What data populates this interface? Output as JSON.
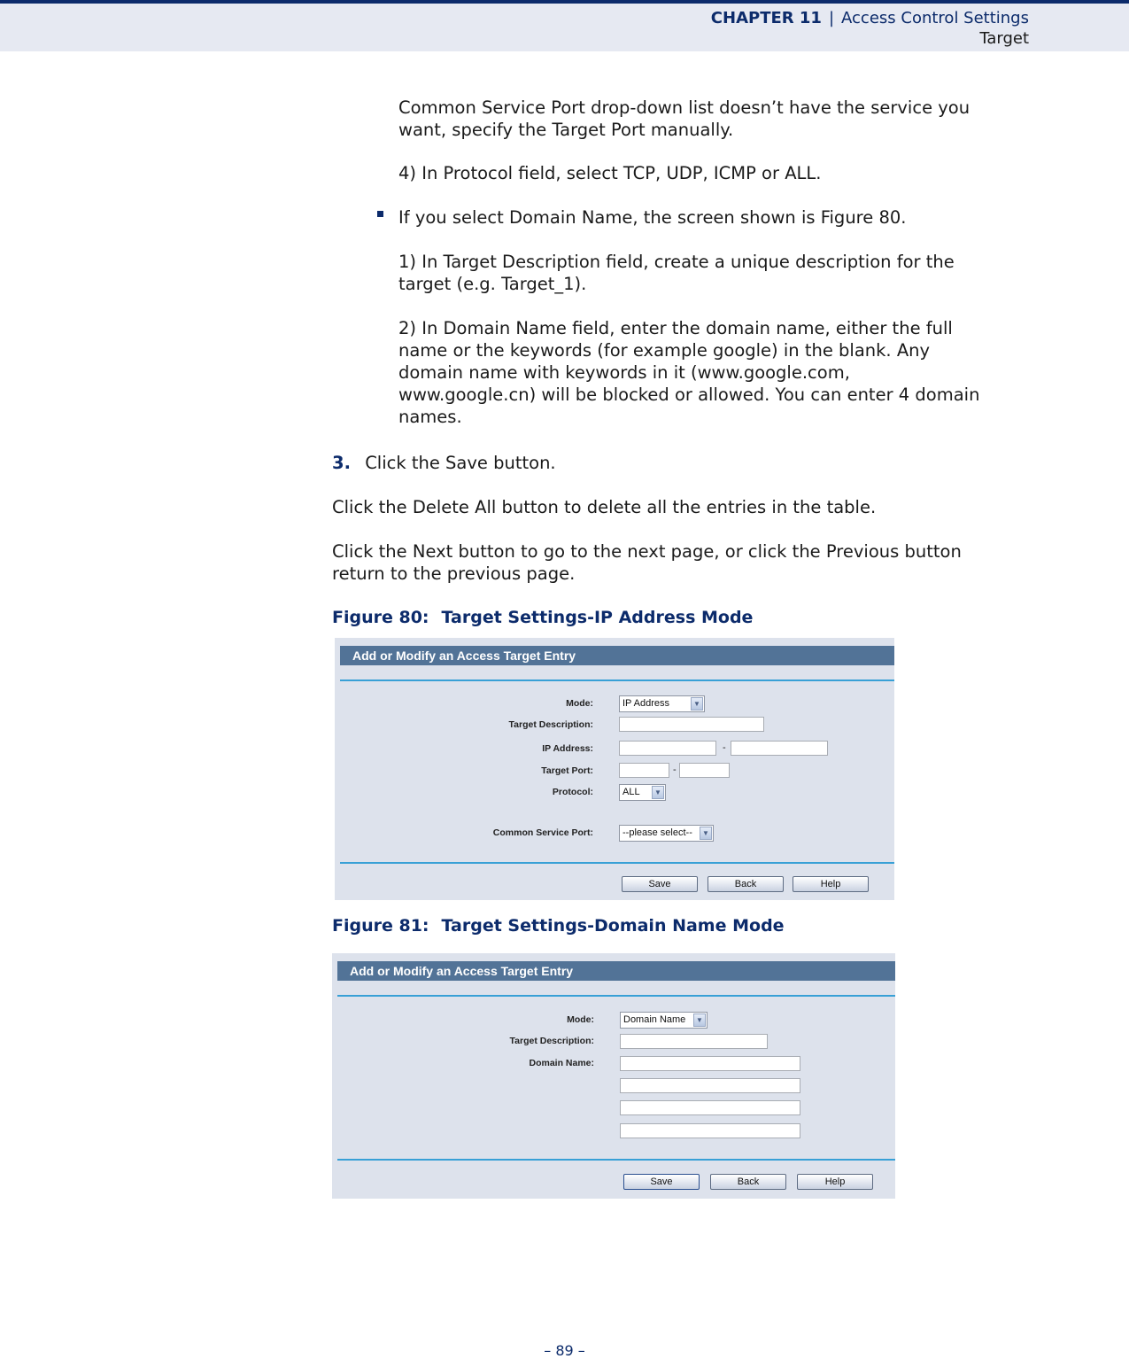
{
  "header": {
    "chapter": "CHAPTER 11",
    "separator": "|",
    "section": "Access Control Settings",
    "subsection": "Target"
  },
  "body": {
    "para_common_service_1": "Common Service Port drop-down list doesn’t have the service you",
    "para_common_service_2": "want, specify the Target Port manually.",
    "step_protocol": "4) In Protocol field, select TCP, UDP, ICMP or ALL.",
    "bullet_domain": "If you select Domain Name, the screen shown is Figure 80.",
    "domain_step1_l1": "1) In Target Description field, create a unique description for the",
    "domain_step1_l2": "target (e.g. Target_1).",
    "domain_step2_l1": "2) In Domain Name field, enter the domain name, either the full",
    "domain_step2_l2": "name or the keywords (for example google) in the blank. Any",
    "domain_step2_l3": "domain name with keywords in it (www.google.com,",
    "domain_step2_l4": "www.google.cn) will be blocked or allowed. You can enter 4 domain",
    "domain_step2_l5": "names.",
    "step3_num": "3.",
    "step3_text": "Click the Save button.",
    "delete_all_text": "Click the Delete All button to delete all the entries in the table.",
    "next_prev_l1": "Click the Next button to go to the next page, or click the Previous button",
    "next_prev_l2": "return to the previous page."
  },
  "figure80": {
    "caption_label": "Figure 80:",
    "caption_title": "Target Settings-IP Address Mode",
    "panel_title": "Add or Modify an Access Target Entry",
    "labels": {
      "mode": "Mode:",
      "target_description": "Target Description:",
      "ip_address": "IP Address:",
      "target_port": "Target Port:",
      "protocol": "Protocol:",
      "common_service_port": "Common Service Port:"
    },
    "mode_value": "IP Address",
    "protocol_value": "ALL",
    "common_service_value": "--please select--",
    "range_separator": "-",
    "buttons": {
      "save": "Save",
      "back": "Back",
      "help": "Help"
    }
  },
  "figure81": {
    "caption_label": "Figure 81:",
    "caption_title": "Target Settings-Domain Name Mode",
    "panel_title": "Add or Modify an Access Target Entry",
    "labels": {
      "mode": "Mode:",
      "target_description": "Target Description:",
      "domain_name": "Domain Name:"
    },
    "mode_value": "Domain Name",
    "buttons": {
      "save": "Save",
      "back": "Back",
      "help": "Help"
    }
  },
  "icons": {
    "dropdown": "chevron-down-icon",
    "bullet": "square-bullet-icon"
  },
  "colors": {
    "header_bg": "#e6e9f2",
    "brand_navy": "#0c2b6b",
    "panel_title_bg": "#527397",
    "panel_bg": "#dde2ec",
    "rule": "#38a0d6"
  },
  "footer": {
    "page_number": "–  89  –"
  }
}
